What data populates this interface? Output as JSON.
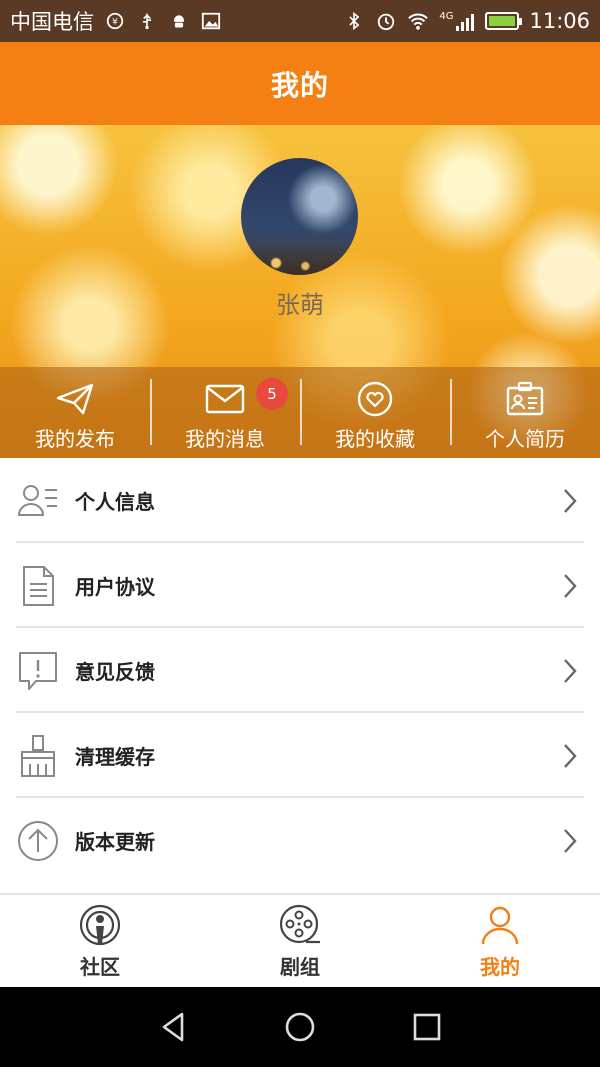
{
  "status_bar": {
    "carrier": "中国电信",
    "network": "4G",
    "time": "11:06",
    "battery_color": "#8bd23f",
    "icons": [
      "carrier-mark-icon",
      "usb-icon",
      "android-icon",
      "image-icon",
      "bluetooth-icon",
      "alarm-icon",
      "wifi-icon",
      "signal-icon",
      "battery-icon"
    ]
  },
  "header": {
    "title": "我的"
  },
  "profile": {
    "username": "张萌",
    "quick_actions": [
      {
        "label": "我的发布",
        "icon": "send-icon"
      },
      {
        "label": "我的消息",
        "icon": "mail-icon",
        "badge": "5"
      },
      {
        "label": "我的收藏",
        "icon": "heart-icon"
      },
      {
        "label": "个人简历",
        "icon": "id-card-icon"
      }
    ]
  },
  "menu": {
    "items": [
      {
        "label": "个人信息",
        "icon": "user-list-icon"
      },
      {
        "label": "用户协议",
        "icon": "document-icon"
      },
      {
        "label": "意见反馈",
        "icon": "feedback-icon"
      },
      {
        "label": "清理缓存",
        "icon": "broom-icon"
      },
      {
        "label": "版本更新",
        "icon": "upload-icon"
      }
    ]
  },
  "tabbar": {
    "tabs": [
      {
        "label": "社区",
        "icon": "podcast-icon",
        "active": false
      },
      {
        "label": "剧组",
        "icon": "film-reel-icon",
        "active": false
      },
      {
        "label": "我的",
        "icon": "person-icon",
        "active": true
      }
    ],
    "accent": "#f47f13"
  },
  "system_nav": {
    "buttons": [
      "back-icon",
      "home-icon",
      "recents-icon"
    ]
  }
}
